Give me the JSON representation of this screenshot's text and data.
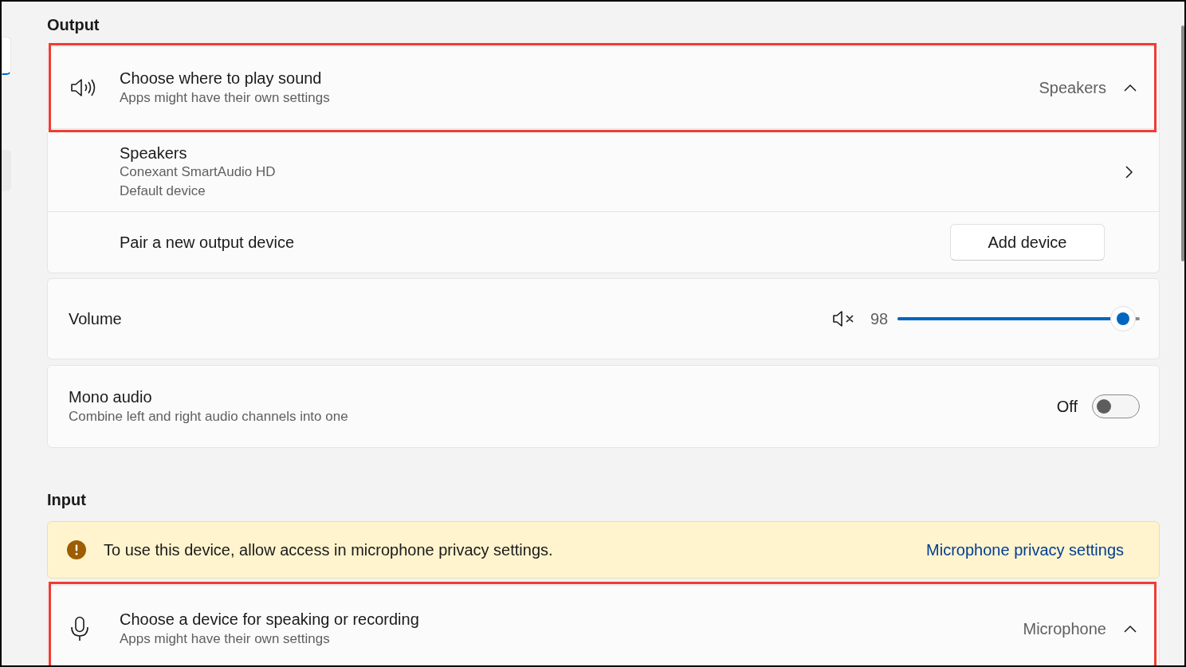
{
  "output": {
    "heading": "Output",
    "device_chooser": {
      "title": "Choose where to play sound",
      "subtitle": "Apps might have their own settings",
      "value": "Speakers",
      "expanded": true,
      "highlighted": true
    },
    "devices": [
      {
        "name": "Speakers",
        "lines": [
          "Conexant SmartAudio HD",
          "Default device"
        ]
      }
    ],
    "pair": {
      "label": "Pair a new output device",
      "button": "Add device"
    },
    "volume": {
      "label": "Volume",
      "reading": "98",
      "level": 0.98
    },
    "mono_audio": {
      "title": "Mono audio",
      "subtitle": "Combine left and right audio channels into one",
      "state_label": "Off",
      "on": false
    }
  },
  "input": {
    "heading": "Input",
    "warning": {
      "text": "To use this device, allow access in microphone privacy settings.",
      "link": "Microphone privacy settings"
    },
    "device_chooser": {
      "title": "Choose a device for speaking or recording",
      "subtitle": "Apps might have their own settings",
      "value": "Microphone",
      "expanded": true,
      "highlighted": true
    }
  }
}
